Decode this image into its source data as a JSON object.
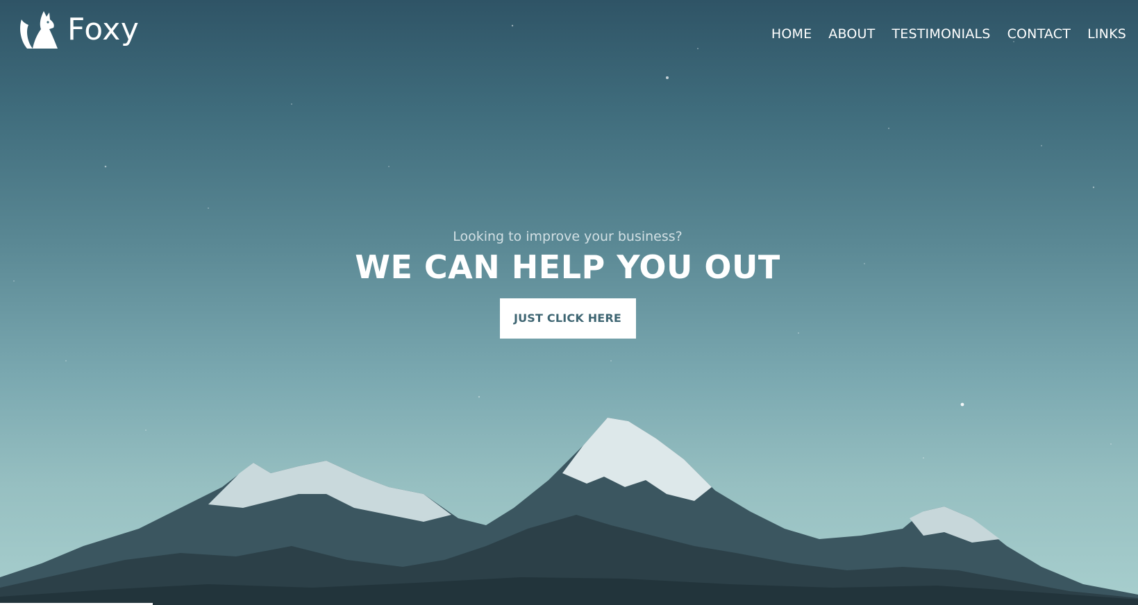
{
  "brand": {
    "name": "Foxy"
  },
  "nav": {
    "items": [
      {
        "label": "HOME"
      },
      {
        "label": "ABOUT"
      },
      {
        "label": "TESTIMONIALS"
      },
      {
        "label": "CONTACT"
      },
      {
        "label": "LINKS"
      }
    ]
  },
  "hero": {
    "subtitle": "Looking to improve your business?",
    "headline": "WE CAN HELP YOU OUT",
    "cta_label": "JUST CLICK HERE"
  },
  "colors": {
    "sky_top": "#2f5466",
    "sky_bottom": "#a8cfce",
    "text": "#ffffff",
    "button_text": "#3e6572"
  }
}
